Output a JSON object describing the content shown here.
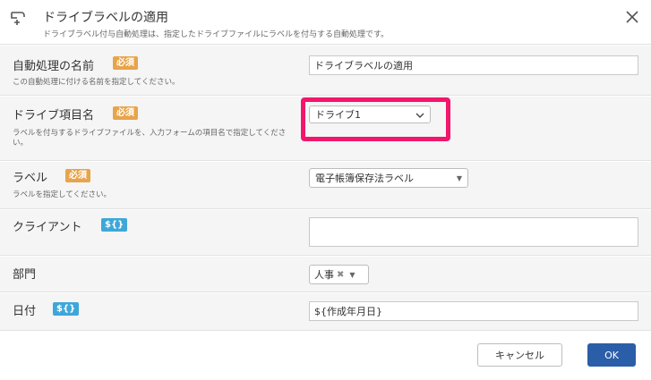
{
  "header": {
    "title": "ドライブラベルの適用",
    "description": "ドライブラベル付与自動処理は、指定したドライブファイルにラベルを付与する自動処理です。"
  },
  "badges": {
    "required": "必須",
    "variable": "${}"
  },
  "fields": {
    "name": {
      "label": "自動処理の名前",
      "description": "この自動処理に付ける名前を指定してください。",
      "value": "ドライブラベルの適用"
    },
    "drive_item": {
      "label": "ドライブ項目名",
      "description": "ラベルを付与するドライブファイルを、入力フォームの項目名で指定してください。",
      "value": "ドライブ1"
    },
    "label": {
      "label": "ラベル",
      "description": "ラベルを指定してください。",
      "value": "電子帳簿保存法ラベル"
    },
    "client": {
      "label": "クライアント",
      "value": ""
    },
    "department": {
      "label": "部門",
      "tag": "人事"
    },
    "date": {
      "label": "日付",
      "value": "${作成年月日}"
    }
  },
  "footer": {
    "cancel_label": "キャンセル",
    "ok_label": "OK"
  },
  "colors": {
    "required_badge": "#e8a44a",
    "variable_badge": "#3ea7d8",
    "highlight": "#f2166c",
    "ok_button": "#2b5ea8"
  }
}
